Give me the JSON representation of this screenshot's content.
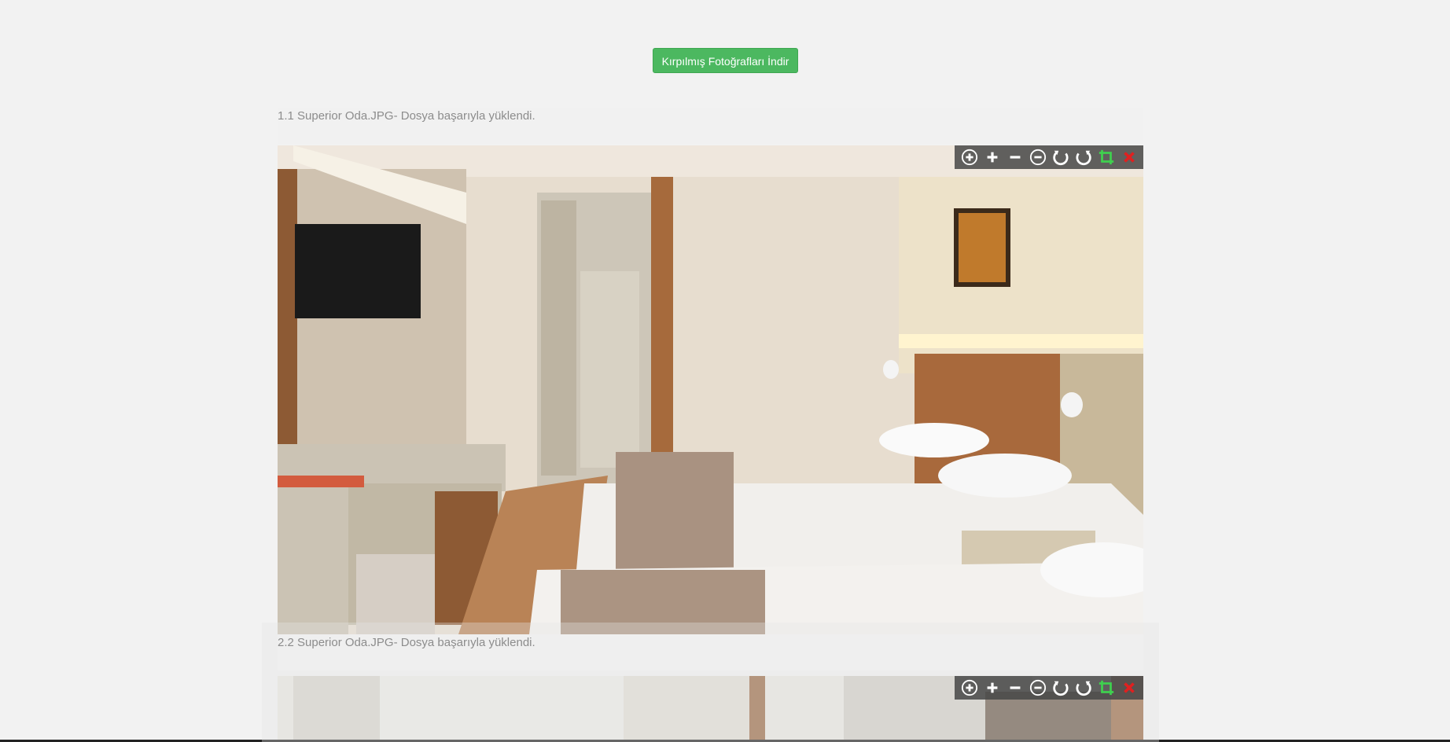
{
  "header": {
    "download_label": "Kırpılmış Fotoğrafları İndir"
  },
  "uploads": [
    {
      "status": "1.1 Superior Oda.JPG- Dosya başarıyla yüklendi."
    },
    {
      "status": "2.2 Superior Oda.JPG- Dosya başarıyla yüklendi."
    }
  ],
  "toolbar_icons": [
    "zoom-in-circle-icon",
    "plus-icon",
    "minus-icon",
    "zoom-out-circle-icon",
    "rotate-left-icon",
    "rotate-right-icon",
    "crop-icon",
    "close-icon"
  ],
  "colors": {
    "button": "#4cb860",
    "crop": "#3fd04f",
    "close": "#e02020",
    "toolbar": "#464646"
  }
}
